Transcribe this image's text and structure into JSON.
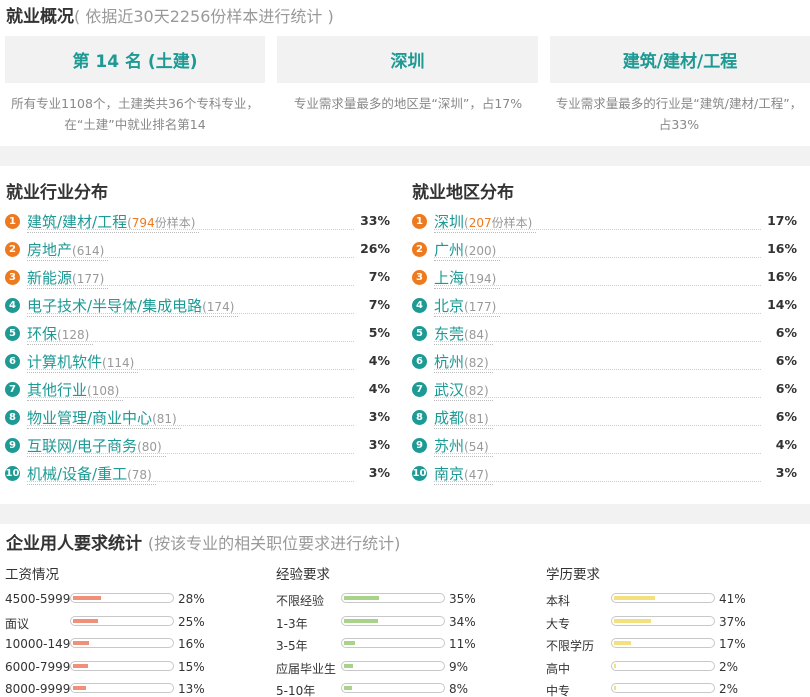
{
  "overview": {
    "title": "就业概况",
    "subtitle": "( 依据近30天2256份样本进行统计 )",
    "cards": [
      {
        "label": "第 14 名 (土建)",
        "desc": "所有专业1108个，土建类共36个专科专业，在“土建”中就业排名第14"
      },
      {
        "label": "深圳",
        "desc": "专业需求量最多的地区是“深圳”，占17%"
      },
      {
        "label": "建筑/建材/工程",
        "desc": "专业需求量最多的行业是“建筑/建材/工程”，占33%"
      }
    ]
  },
  "industry": {
    "title": "就业行业分布",
    "items": [
      {
        "rank": "1",
        "name": "建筑/建材/工程",
        "count": "794",
        "suffix": "份样本",
        "pct": "33%"
      },
      {
        "rank": "2",
        "name": "房地产",
        "count": "614",
        "pct": "26%"
      },
      {
        "rank": "3",
        "name": "新能源",
        "count": "177",
        "pct": "7%"
      },
      {
        "rank": "4",
        "name": "电子技术/半导体/集成电路",
        "count": "174",
        "pct": "7%"
      },
      {
        "rank": "5",
        "name": "环保",
        "count": "128",
        "pct": "5%"
      },
      {
        "rank": "6",
        "name": "计算机软件",
        "count": "114",
        "pct": "4%"
      },
      {
        "rank": "7",
        "name": "其他行业",
        "count": "108",
        "pct": "4%"
      },
      {
        "rank": "8",
        "name": "物业管理/商业中心",
        "count": "81",
        "pct": "3%"
      },
      {
        "rank": "9",
        "name": "互联网/电子商务",
        "count": "80",
        "pct": "3%"
      },
      {
        "rank": "10",
        "name": "机械/设备/重工",
        "count": "78",
        "pct": "3%"
      }
    ]
  },
  "region": {
    "title": "就业地区分布",
    "items": [
      {
        "rank": "1",
        "name": "深圳",
        "count": "207",
        "suffix": "份样本",
        "pct": "17%"
      },
      {
        "rank": "2",
        "name": "广州",
        "count": "200",
        "pct": "16%"
      },
      {
        "rank": "3",
        "name": "上海",
        "count": "194",
        "pct": "16%"
      },
      {
        "rank": "4",
        "name": "北京",
        "count": "177",
        "pct": "14%"
      },
      {
        "rank": "5",
        "name": "东莞",
        "count": "84",
        "pct": "6%"
      },
      {
        "rank": "6",
        "name": "杭州",
        "count": "82",
        "pct": "6%"
      },
      {
        "rank": "7",
        "name": "武汉",
        "count": "82",
        "pct": "6%"
      },
      {
        "rank": "8",
        "name": "成都",
        "count": "81",
        "pct": "6%"
      },
      {
        "rank": "9",
        "name": "苏州",
        "count": "54",
        "pct": "4%"
      },
      {
        "rank": "10",
        "name": "南京",
        "count": "47",
        "pct": "3%"
      }
    ]
  },
  "requirements": {
    "title": "企业用人要求统计",
    "subtitle": "(按该专业的相关职位要求进行统计)",
    "groups": [
      {
        "title": "工资情况",
        "color": "#f0907a",
        "items": [
          {
            "label": "4500-5999",
            "pct": "28%"
          },
          {
            "label": "面议",
            "pct": "25%"
          },
          {
            "label": "10000-14999",
            "pct": "16%"
          },
          {
            "label": "6000-7999",
            "pct": "15%"
          },
          {
            "label": "8000-9999",
            "pct": "13%"
          }
        ]
      },
      {
        "title": "经验要求",
        "color": "#a9d38a",
        "items": [
          {
            "label": "不限经验",
            "pct": "35%"
          },
          {
            "label": "1-3年",
            "pct": "34%"
          },
          {
            "label": "3-5年",
            "pct": "11%"
          },
          {
            "label": "应届毕业生",
            "pct": "9%"
          },
          {
            "label": "5-10年",
            "pct": "8%"
          }
        ]
      },
      {
        "title": "学历要求",
        "color": "#f4e07e",
        "items": [
          {
            "label": "本科",
            "pct": "41%"
          },
          {
            "label": "大专",
            "pct": "37%"
          },
          {
            "label": "不限学历",
            "pct": "17%"
          },
          {
            "label": "高中",
            "pct": "2%"
          },
          {
            "label": "中专",
            "pct": "2%"
          }
        ]
      }
    ]
  }
}
